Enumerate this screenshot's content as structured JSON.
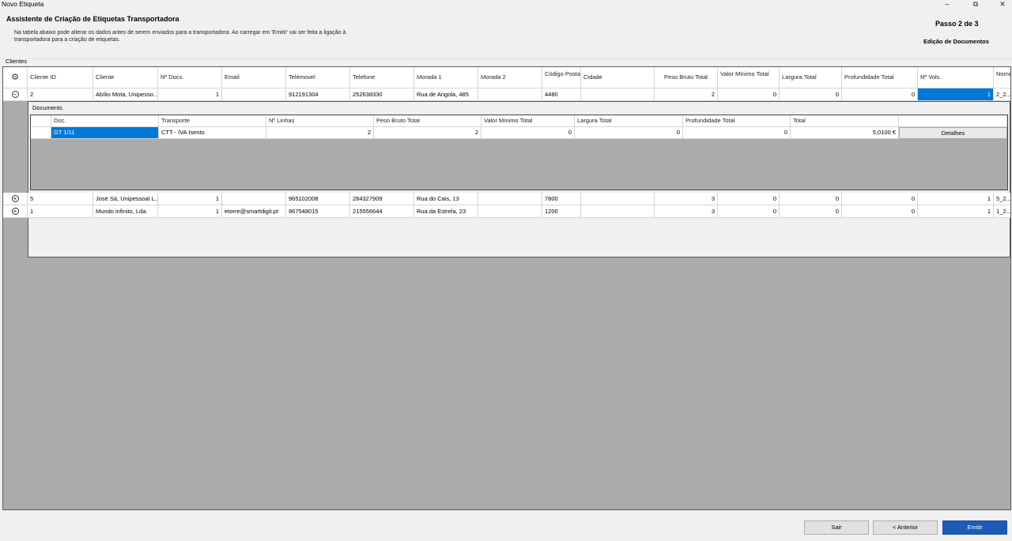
{
  "window": {
    "title": "Novo Etiqueta"
  },
  "header": {
    "title": "Assistente de Criação de Etiquetas Transportadora",
    "description": "Na tabela abaixo pode alterar os dados antes de serem enviados para a transportadora. Ao carregar em 'Emitir' vai ser feita a ligação à transportadora para a criação de etiquetas.",
    "step": "Passo 2 de 3",
    "step_name": "Edição de Documentos"
  },
  "clients_group_label": "Clientes",
  "clients_table": {
    "columns": [
      "Cliente ID",
      "Cliente",
      "Nº Docs.",
      "Email",
      "Telémovel",
      "Telefone",
      "Morada 1",
      "Morada 2",
      "Código Postal",
      "Cidade",
      "Peso Bruto Total",
      "Valor Mínimo Total",
      "Largura Total",
      "Profundidade Total",
      "Nº Vols.",
      "Nome Fiche"
    ],
    "rows": [
      [
        "2",
        "Abílio Mota, Unipesso...",
        "1",
        "",
        "912191304",
        "252638330",
        "Rua de Angola, 485",
        "",
        "4480",
        "",
        "2",
        "0",
        "0",
        "0",
        "1",
        "2_2..."
      ],
      [
        "5",
        "José Sá, Unipessoal L...",
        "1",
        "",
        "965102008",
        "284327909",
        "Rua do Cais, 13",
        "",
        "7800",
        "",
        "3",
        "0",
        "0",
        "0",
        "1",
        "5_2..."
      ],
      [
        "1",
        "Mundo infinito, Lda.",
        "1",
        "etorre@smartdigit.pt",
        "967548015",
        "215556644",
        "Rua da Estrela, 23",
        "",
        "1200",
        "",
        "3",
        "0",
        "0",
        "0",
        "1",
        "1_2..."
      ]
    ]
  },
  "documents_label": "Documents",
  "documents_table": {
    "columns": [
      "Doc.",
      "Transporte",
      "Nº Linhas",
      "Peso Bruto Total",
      "Valor Mínimo Total",
      "Largura Total",
      "Profundidade Total",
      "Total",
      ""
    ],
    "rows": [
      [
        "GT 1/11",
        "CTT - IVA Isento",
        "2",
        "2",
        "0",
        "0",
        "0",
        "5,0100 €",
        "Detalhes"
      ]
    ]
  },
  "footer": {
    "exit": "Sair",
    "back": "< Anterior",
    "emit": "Emitir"
  }
}
